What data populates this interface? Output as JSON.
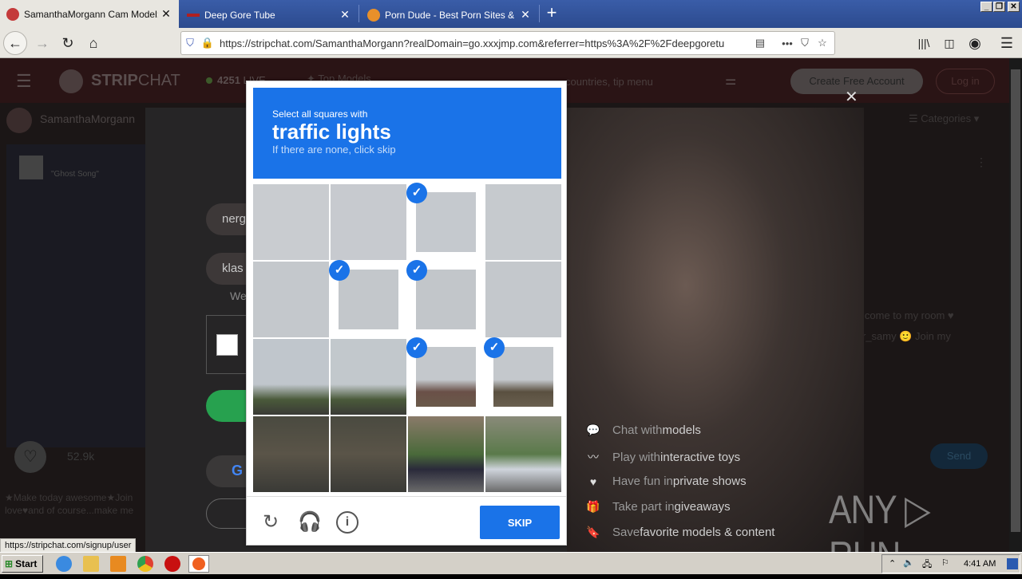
{
  "browser": {
    "tabs": [
      {
        "title": "SamanthaMorgann Cam Model: Fr",
        "active": true,
        "icon": "stripchat-favicon"
      },
      {
        "title": "Deep Gore Tube",
        "active": false,
        "icon": "site-favicon"
      },
      {
        "title": "Porn Dude - Best Porn Sites & Free",
        "active": false,
        "icon": "porndude-favicon"
      }
    ],
    "new_tab_label": "+",
    "close_glyph": "✕",
    "url": "https://stripchat.com/SamanthaMorgann?realDomain=go.xxxjmp.com&referrer=https%3A%2F%2Fdeepgoretu",
    "status_url": "https://stripchat.com/signup/user"
  },
  "site": {
    "logo_text_bold": "STRIP",
    "logo_text": "CHAT",
    "live_count": "4251",
    "live_label": "LIVE",
    "top_models": "Top Models",
    "search_placeholder": "countries, tip menu",
    "create_account": "Create Free Account",
    "login": "Log in",
    "categories": "Categories",
    "model_name": "SamanthaMorgann",
    "song": "\"Ghost Song\"",
    "likes": "52.9k",
    "bio_line1": "★Make today awesome★Join",
    "bio_line2": "love♥and of course...make me",
    "chat_line1": "lcome to my room ♥",
    "chat_line2": "r_samy 🙂 Join my",
    "send": "Send"
  },
  "signup_modal": {
    "field1_partial": "nerg",
    "field2_partial": "klas",
    "partial_text": "We",
    "close_glyph": "✕",
    "features": [
      {
        "icon": "chat-icon",
        "glyph": "💬",
        "prefix": "Chat with ",
        "highlight": "models"
      },
      {
        "icon": "toy-icon",
        "glyph": "〰",
        "prefix": "Play with ",
        "highlight": "interactive toys"
      },
      {
        "icon": "heart-icon",
        "glyph": "♥",
        "prefix": "Have fun in ",
        "highlight": "private shows"
      },
      {
        "icon": "gift-icon",
        "glyph": "🎁",
        "prefix": "Take part in ",
        "highlight": "giveaways"
      },
      {
        "icon": "bookmark-icon",
        "glyph": "🔖",
        "prefix": "Save ",
        "highlight": "favorite models & content"
      }
    ]
  },
  "captcha": {
    "instruction": "Select all squares with",
    "target": "traffic lights",
    "hint": "If there are none, click skip",
    "grid_selected": [
      false,
      false,
      true,
      false,
      false,
      true,
      true,
      false,
      false,
      false,
      true,
      true,
      false,
      false,
      false,
      false
    ],
    "skip_label": "SKIP",
    "check_glyph": "✓"
  },
  "taskbar": {
    "start_label": "Start",
    "clock": "4:41 AM"
  },
  "watermark": "ANY ▷ RUN"
}
